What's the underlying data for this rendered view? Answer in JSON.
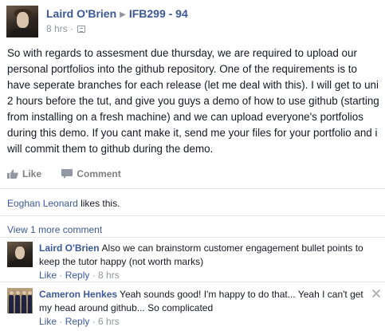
{
  "post": {
    "author": "Laird O'Brien",
    "group": "IFB299 - 94",
    "time": "8 hrs",
    "body": "So with regards to assesment due thursday, we are required to upload our personal portfolios into the github repository. One of the requirements is to have seperate branches for each release (let me deal with this). I will get to uni 2 hours before the tut, and give you guys a demo of how to use github (starting from installing on a fresh machine) and we can upload everyone's portfolios during this demo. If you cant make it, send me your files for your portfolio and i will commit them to github during the demo."
  },
  "actions": {
    "like_label": "Like",
    "comment_label": "Comment"
  },
  "likes": {
    "liker": "Eoghan Leonard",
    "suffix": " likes this."
  },
  "view_more_label": "View 1 more comment",
  "comments": [
    {
      "author": "Laird O'Brien",
      "text": "Also we can brainstorm customer engagement bullet points to keep the tutor happy (not worth marks)",
      "like_label": "Like",
      "reply_label": "Reply",
      "time": "8 hrs"
    },
    {
      "author": "Cameron Henkes",
      "text": "Yeah sounds good! I'm happy to do that... Yeah I can't get my head around github... So complicated",
      "like_label": "Like",
      "reply_label": "Reply",
      "time": "6 hrs"
    }
  ],
  "icons": {
    "group_arrow": "triangle-right-icon",
    "privacy": "group-privacy-icon",
    "like": "thumbs-up-icon",
    "comment": "speech-bubble-icon",
    "close": "close-icon"
  },
  "colors": {
    "link": "#3b5998",
    "meta": "#90949c",
    "text": "#141823",
    "action": "#7f7f7f",
    "separator": "#e5e5e5"
  }
}
